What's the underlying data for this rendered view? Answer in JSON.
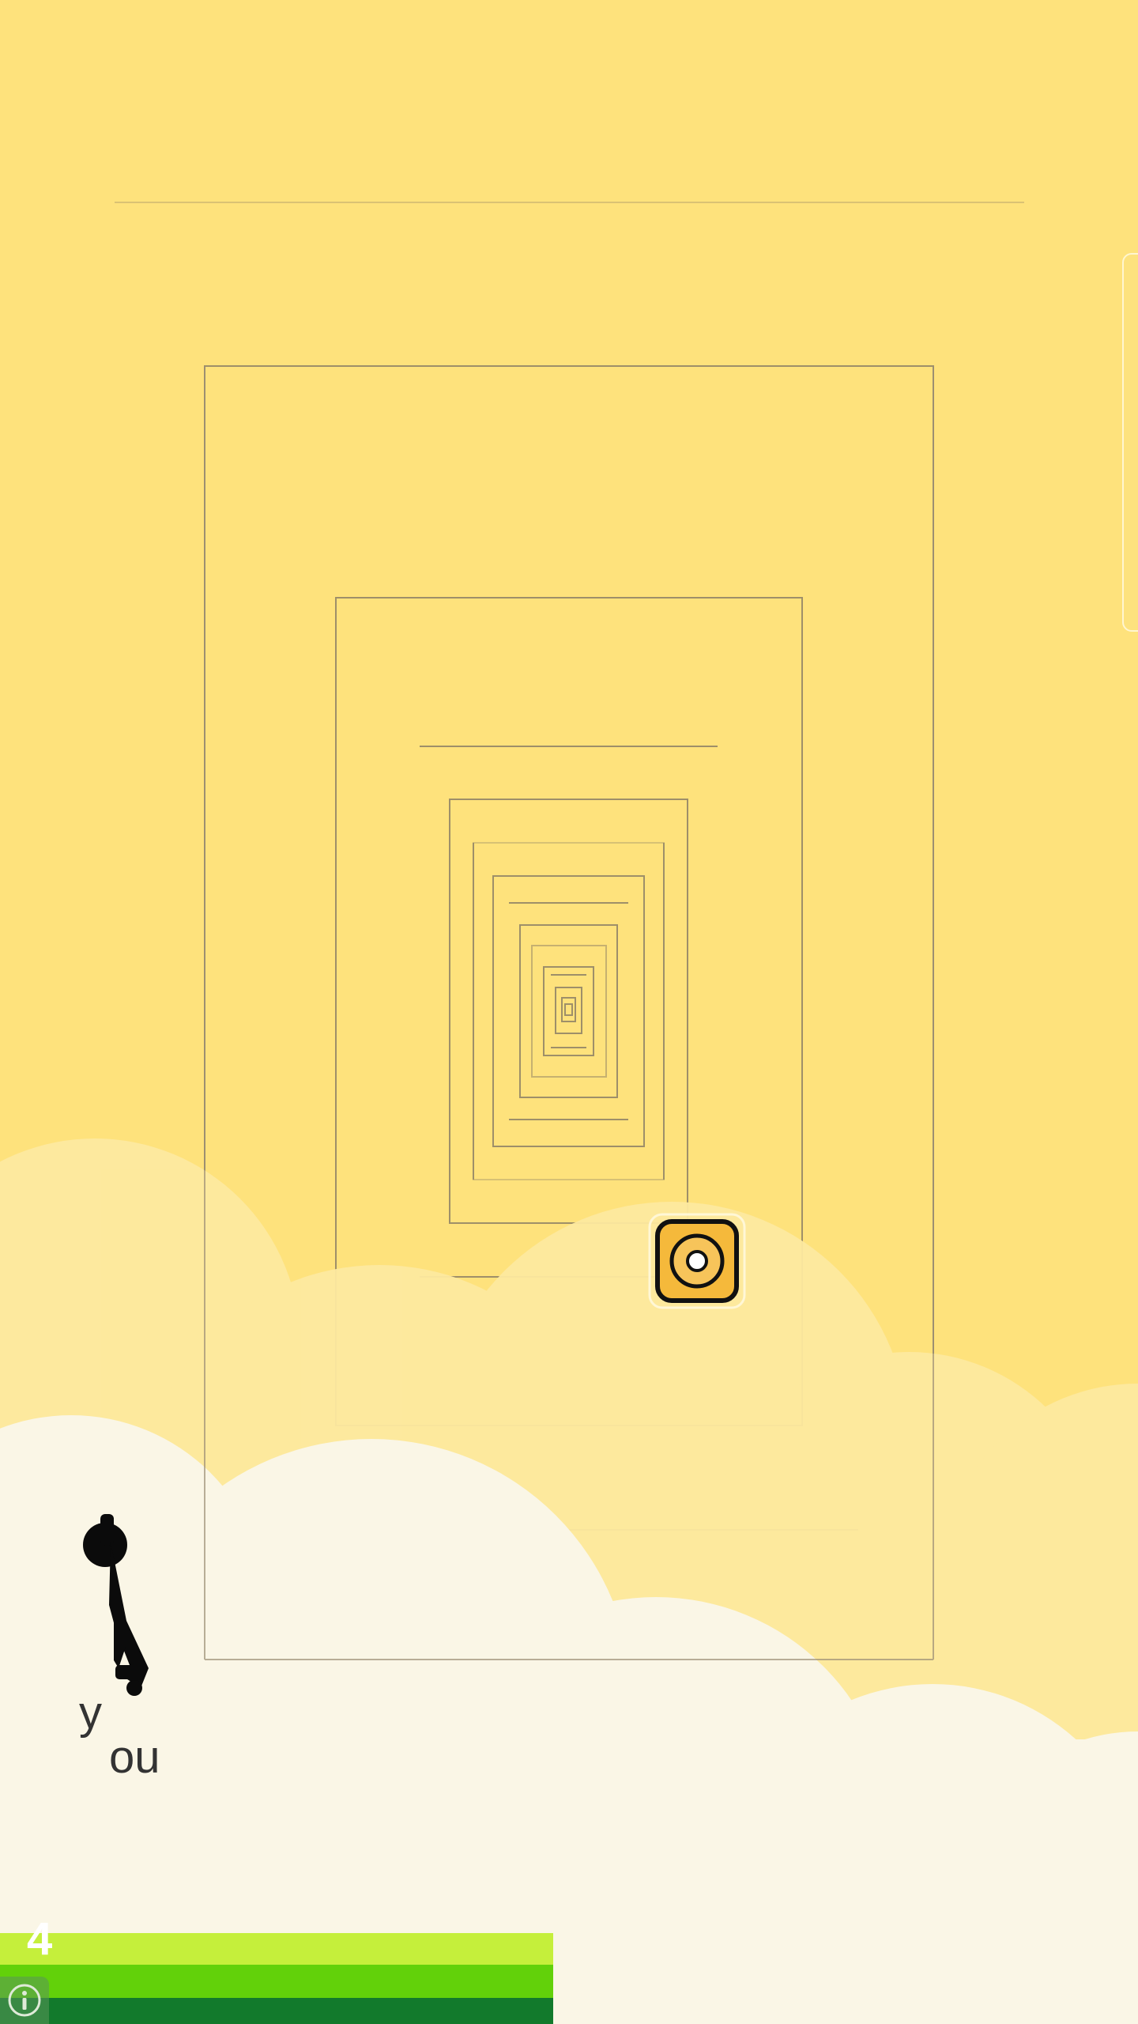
{
  "game": {
    "player_label_line1": "y",
    "player_label_line2": "ou",
    "level_number": "4"
  },
  "icons": {
    "target": "target-button-icon",
    "info": "info-icon",
    "player": "stick-figure-player"
  },
  "colors": {
    "sky": "#fee27c",
    "cloud_far": "#fde9a0",
    "cloud_near": "#faf6e6",
    "target_fill": "#f5b93b",
    "bar_light": "#c5ef3b",
    "bar_mid": "#62d10a",
    "bar_dark": "#127a2c"
  }
}
